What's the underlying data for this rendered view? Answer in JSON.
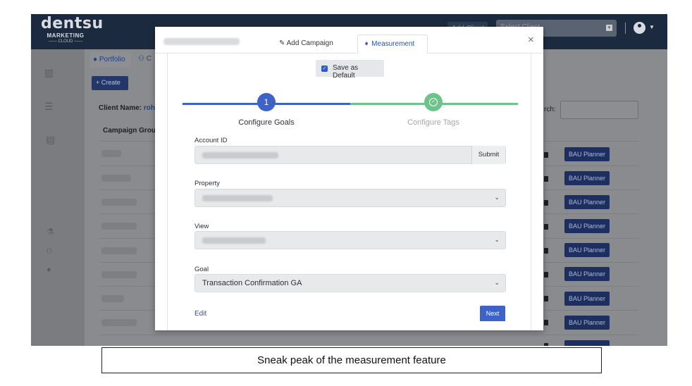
{
  "brand": {
    "name": "dentsu",
    "sub": "MARKETING",
    "sub2": "—— CLOUD ——"
  },
  "topbar": {
    "client_button": "Add Client",
    "client_select_placeholder": "Select Client"
  },
  "tabs": {
    "portfolio": "Portfolio",
    "other": "C"
  },
  "toolbar": {
    "create_label": "+ Create"
  },
  "client": {
    "label": "Client Name:",
    "value": "roha"
  },
  "table": {
    "col_campaign_group": "Campaign Grou",
    "search_label": "rch:",
    "row_action_label": "BAU Planner"
  },
  "modal": {
    "tabs": {
      "add_campaign": "Add Campaign",
      "measurement": "Measurement"
    },
    "save_default_label": "Save as Default",
    "steps": [
      {
        "number": "1",
        "label": "Configure Goals"
      },
      {
        "label": "Configure Tags"
      }
    ],
    "fields": {
      "account_id_label": "Account ID",
      "submit_label": "Submit",
      "property_label": "Property",
      "view_label": "View",
      "goal_label": "Goal",
      "goal_value": "Transaction Confirmation GA"
    },
    "edit_label": "Edit",
    "next_label": "Next"
  },
  "caption": "Sneak peak of the measurement feature",
  "colors": {
    "primary": "#3d63c9",
    "success": "#6cc48a",
    "navbar": "#1c2a3f"
  }
}
